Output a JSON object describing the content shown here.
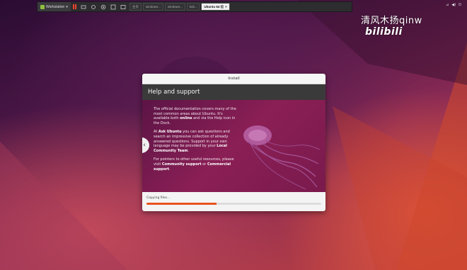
{
  "vm_toolbar": {
    "workspace_label": "Workstation",
    "tabs": [
      {
        "label": "主页",
        "active": false
      },
      {
        "label": "windows...",
        "active": false
      },
      {
        "label": "windows...",
        "active": false
      },
      {
        "label": "kali...",
        "active": false
      },
      {
        "label": "Ubuntu 64 位",
        "active": true
      }
    ],
    "icons": [
      "pause-icon",
      "snapshot-icon",
      "revert-icon",
      "manage-icon",
      "fullscreen-icon",
      "console-icon"
    ]
  },
  "guest_status": {
    "icons": [
      "network-icon",
      "volume-icon",
      "power-icon"
    ]
  },
  "watermark": {
    "text": "清风木扬qinw",
    "brand": "bilibili"
  },
  "installer": {
    "window_title": "Install",
    "header_title": "Help and support",
    "slide": {
      "para1_a": "The official documentation covers many of the most common areas about Ubuntu. It's available both ",
      "para1_b": "online",
      "para1_c": " and via the Help icon in the Dock.",
      "para2_a": "At ",
      "para2_b": "Ask Ubuntu",
      "para2_c": " you can ask questions and search an impressive collection of already answered questions. Support in your own language may be provided by your ",
      "para2_d": "Local Community Team",
      "para2_e": ".",
      "para3_a": "For pointers to other useful resources, please visit ",
      "para3_b": "Community support",
      "para3_c": " or ",
      "para3_d": "Commercial support",
      "para3_e": "."
    },
    "status_text": "Copying files...",
    "progress": 0.4
  },
  "colors": {
    "accent": "#e95420",
    "vm_toolbar_bg": "#2d2d30",
    "header_bg": "#3a3a3a"
  }
}
